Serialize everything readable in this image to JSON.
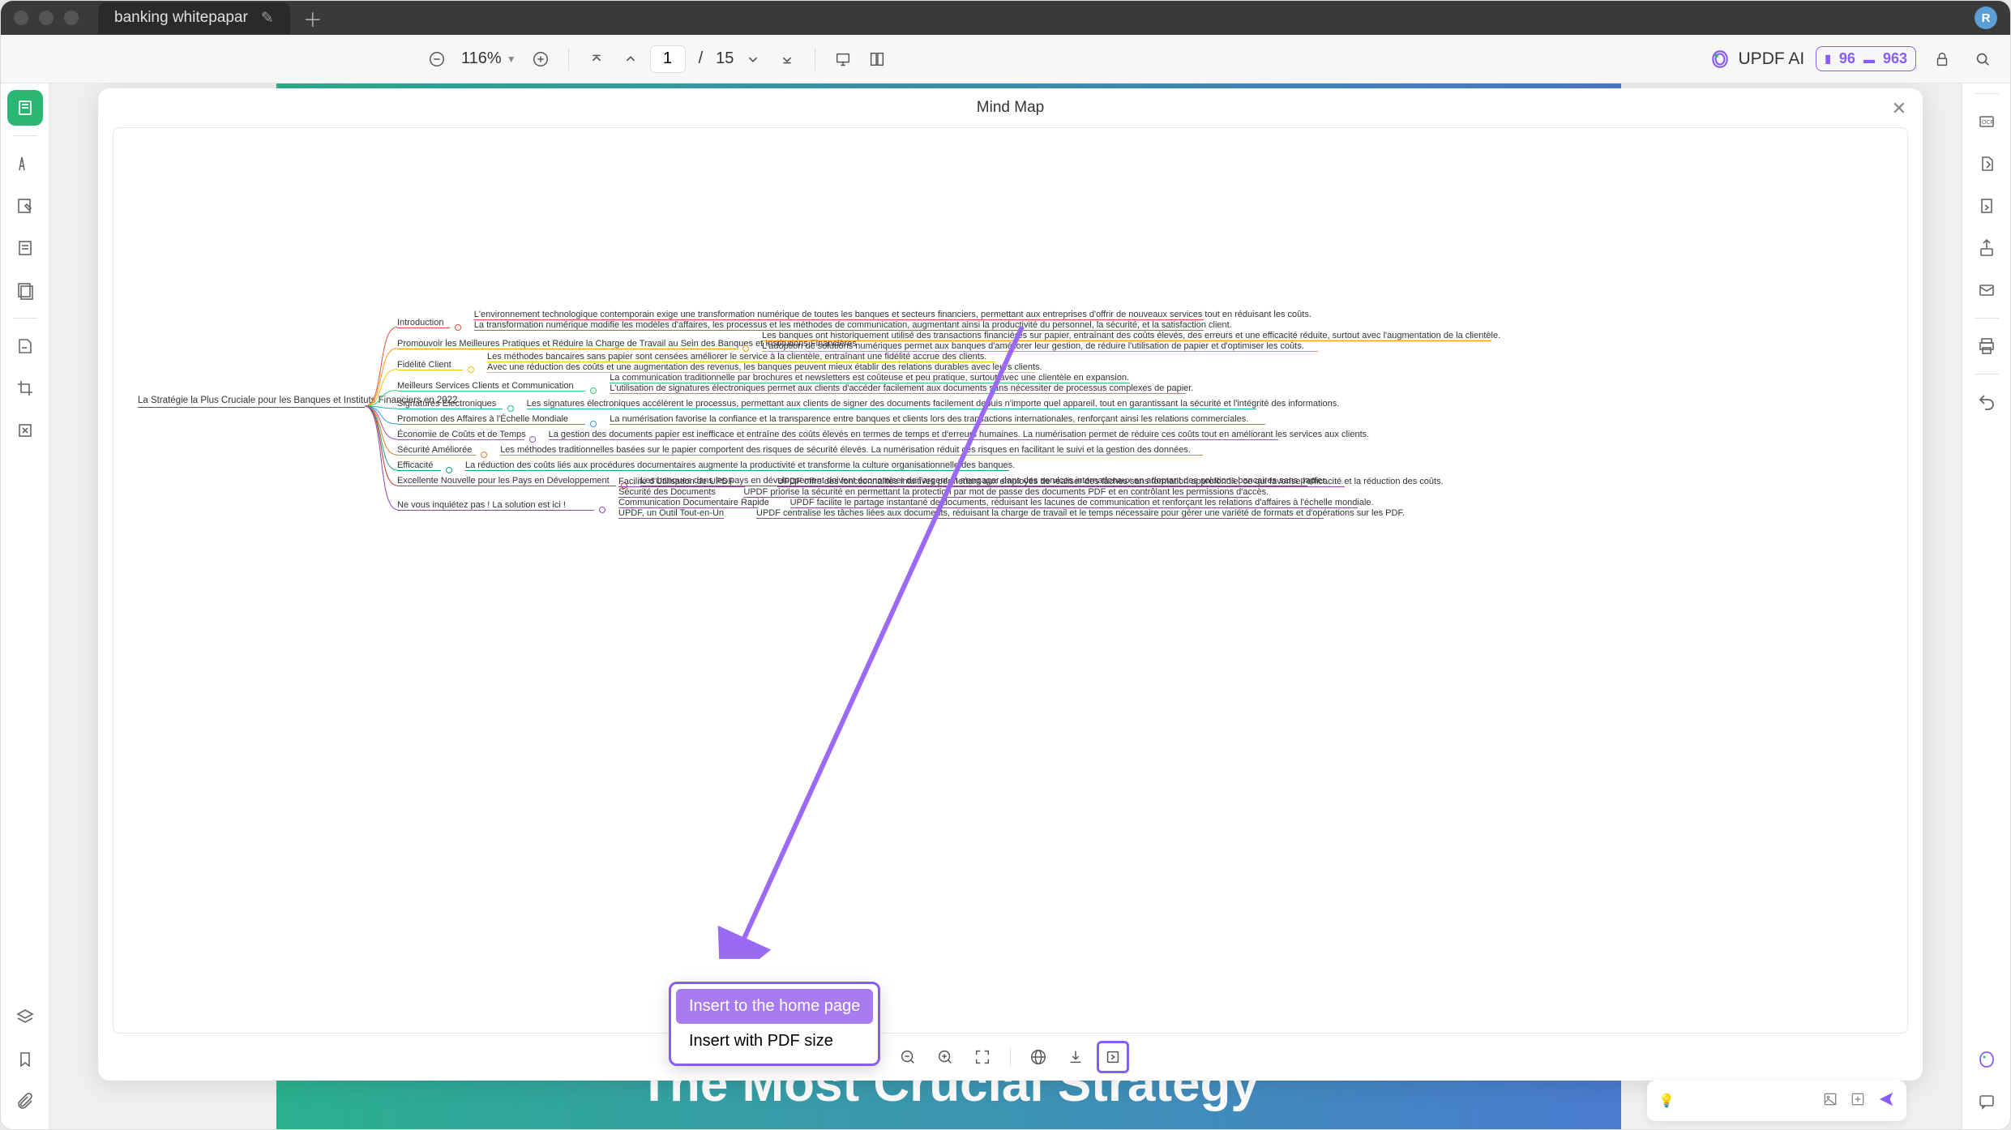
{
  "window": {
    "tab_title": "banking whitepapar",
    "avatar_letter": "R"
  },
  "toolbar": {
    "zoom": "116%",
    "page_current": "1",
    "page_sep": "/",
    "page_total": "15",
    "ai_label": "UPDF AI",
    "credit1": "96",
    "credit2": "963"
  },
  "modal": {
    "title": "Mind Map"
  },
  "popup": {
    "opt1": "Insert to the home page",
    "opt2": "Insert with PDF size"
  },
  "doc": {
    "headline": "The Most Crucial Strategy"
  },
  "mindmap": {
    "root": "La Stratégie la Plus Cruciale pour les Banques et Instituts Financiers en 2022",
    "branches": [
      {
        "label": "Introduction",
        "children": [
          "L'environnement technologique contemporain exige une transformation numérique de toutes les banques et secteurs financiers, permettant aux entreprises d'offrir de nouveaux services tout en réduisant les coûts.",
          "La transformation numérique modifie les modèles d'affaires, les processus et les méthodes de communication, augmentant ainsi la productivité du personnel, la sécurité, et la satisfaction client."
        ]
      },
      {
        "label": "Promouvoir les Meilleures Pratiques et Réduire la Charge de Travail au Sein des Banques et Institutions Financières",
        "children": [
          "Les banques ont historiquement utilisé des transactions financières sur papier, entraînant des coûts élevés, des erreurs et une efficacité réduite, surtout avec l'augmentation de la clientèle.",
          "L'adoption de solutions numériques permet aux banques d'améliorer leur gestion, de réduire l'utilisation de papier et d'optimiser les coûts."
        ]
      },
      {
        "label": "Fidélité Client",
        "children": [
          "Les méthodes bancaires sans papier sont censées améliorer le service à la clientèle, entraînant une fidélité accrue des clients.",
          "Avec une réduction des coûts et une augmentation des revenus, les banques peuvent mieux établir des relations durables avec leurs clients."
        ]
      },
      {
        "label": "Meilleurs Services Clients et Communication",
        "children": [
          "La communication traditionnelle par brochures et newsletters est coûteuse et peu pratique, surtout avec une clientèle en expansion.",
          "L'utilisation de signatures électroniques permet aux clients d'accéder facilement aux documents sans nécessiter de processus complexes de papier."
        ]
      },
      {
        "label": "Signatures Électroniques",
        "children": [
          "Les signatures électroniques accélèrent le processus, permettant aux clients de signer des documents facilement depuis n'importe quel appareil, tout en garantissant la sécurité et l'intégrité des informations."
        ]
      },
      {
        "label": "Promotion des Affaires à l'Échelle Mondiale",
        "children": [
          "La numérisation favorise la confiance et la transparence entre banques et clients lors des transactions internationales, renforçant ainsi les relations commerciales."
        ]
      },
      {
        "label": "Économie de Coûts et de Temps",
        "children": [
          "La gestion des documents papier est inefficace et entraîne des coûts élevés en termes de temps et d'erreurs humaines. La numérisation permet de réduire ces coûts tout en améliorant les services aux clients."
        ]
      },
      {
        "label": "Sécurité Améliorée",
        "children": [
          "Les méthodes traditionnelles basées sur le papier comportent des risques de sécurité élevés. La numérisation réduit ces risques en facilitant le suivi et la gestion des données."
        ]
      },
      {
        "label": "Efficacité",
        "children": [
          "La réduction des coûts liés aux procédures documentaires augmente la productivité et transforme la culture organisationnelle des banques."
        ]
      },
      {
        "label": "Excellente Nouvelle pour les Pays en Développement",
        "children": [
          "Les banques dans les pays en développement doivent économiser de l'argent et s'engager dans des services internationaux en adoptant des solutions bancaires sans papier."
        ]
      },
      {
        "label": "Ne vous inquiétez pas ! La solution est ici !",
        "children": [
          {
            "label": "Facilité d'Utilisation de UPDF",
            "desc": "UPDF offre des fonctionnalités intuitives permettant aux employés de réaliser des tâches sans formation approfondie, ce qui favorise l'efficacité et la réduction des coûts."
          },
          {
            "label": "Sécurité des Documents",
            "desc": "UPDF priorise la sécurité en permettant la protection par mot de passe des documents PDF et en contrôlant les permissions d'accès."
          },
          {
            "label": "Communication Documentaire Rapide",
            "desc": "UPDF facilite le partage instantané de documents, réduisant les lacunes de communication et renforçant les relations d'affaires à l'échelle mondiale."
          },
          {
            "label": "UPDF, un Outil Tout-en-Un",
            "desc": "UPDF centralise les tâches liées aux documents, réduisant la charge de travail et le temps nécessaire pour gérer une variété de formats et d'opérations sur les PDF."
          }
        ]
      }
    ]
  },
  "colors": {
    "accent": "#8a5cf6",
    "green": "#2bb673"
  }
}
